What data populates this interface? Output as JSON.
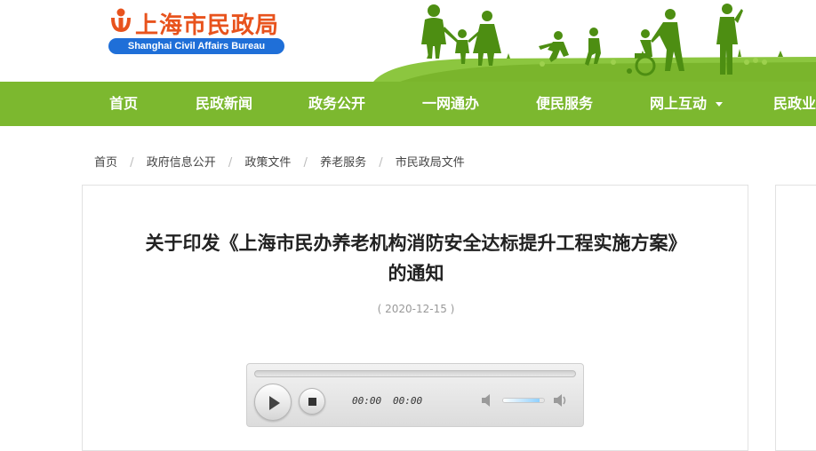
{
  "site": {
    "title": "上海市民政局",
    "subtitle": "Shanghai Civil Affairs Bureau"
  },
  "nav": {
    "items": [
      {
        "label": "首页"
      },
      {
        "label": "民政新闻"
      },
      {
        "label": "政务公开"
      },
      {
        "label": "一网通办"
      },
      {
        "label": "便民服务"
      },
      {
        "label": "网上互动",
        "has_dropdown": true
      },
      {
        "label": "民政业"
      }
    ]
  },
  "breadcrumb": {
    "items": [
      "首页",
      "政府信息公开",
      "政策文件",
      "养老服务",
      "市民政局文件"
    ],
    "separator": "/"
  },
  "article": {
    "title": "关于印发《上海市民办养老机构消防安全达标提升工程实施方案》的通知",
    "date": "( 2020-12-15 )"
  },
  "player": {
    "current_time": "00:00",
    "duration": "00:00",
    "volume_fraction": 0.9,
    "volume_fill": "90%"
  },
  "colors": {
    "nav_green": "#7cb82f",
    "logo_orange": "#e8531d",
    "logo_blue": "#1f6fd8",
    "silhouette_green": "#4d8e12"
  }
}
